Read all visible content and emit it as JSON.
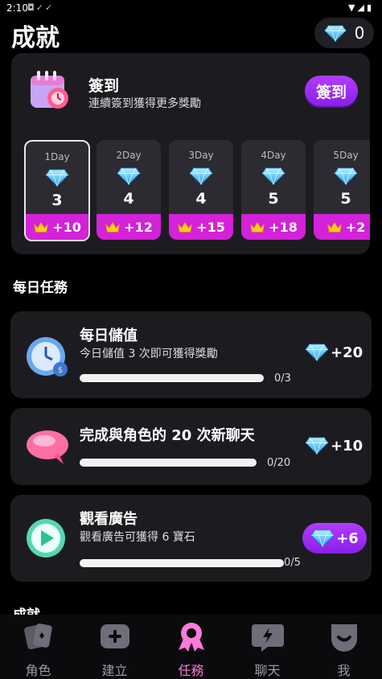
{
  "status_bar": {
    "time": "2:10",
    "icons": [
      "camera-icon",
      "check-icon",
      "check-icon"
    ],
    "right_icons": [
      "wifi-icon",
      "signal-icon",
      "battery-icon"
    ]
  },
  "header": {
    "title": "成就",
    "gem_count": "0"
  },
  "checkin": {
    "title": "簽到",
    "subtitle": "連續簽到獲得更多獎勵",
    "button_label": "簽到",
    "days": [
      {
        "label": "1Day",
        "value": "3",
        "bonus": "+10",
        "active": true
      },
      {
        "label": "2Day",
        "value": "4",
        "bonus": "+12",
        "active": false
      },
      {
        "label": "3Day",
        "value": "4",
        "bonus": "+15",
        "active": false
      },
      {
        "label": "4Day",
        "value": "5",
        "bonus": "+18",
        "active": false
      },
      {
        "label": "5Day",
        "value": "5",
        "bonus": "+2",
        "active": false
      }
    ]
  },
  "daily": {
    "section_title": "每日任務",
    "tasks": [
      {
        "title": "每日儲值",
        "subtitle": "今日儲值 3 次即可獲得獎勵",
        "progress": "0/3",
        "progress_fraction": 0,
        "reward": "+20"
      },
      {
        "title": "完成與角色的 20 次新聊天",
        "subtitle": "",
        "progress": "0/20",
        "progress_fraction": 0,
        "reward": "+10"
      },
      {
        "title": "觀看廣告",
        "subtitle": "觀看廣告可獲得 6 寶石",
        "progress": "0/5",
        "progress_fraction": 0,
        "reward": "+6"
      }
    ]
  },
  "achievements_peek": "成就",
  "tabs": [
    {
      "label": "角色",
      "icon": "cards-icon",
      "active": false
    },
    {
      "label": "建立",
      "icon": "add-icon",
      "active": false
    },
    {
      "label": "任務",
      "icon": "ribbon-icon",
      "active": true
    },
    {
      "label": "聊天",
      "icon": "chat-bolt-icon",
      "active": false
    },
    {
      "label": "我",
      "icon": "profile-icon",
      "active": false
    }
  ],
  "colors": {
    "accent_purple": "#a02ff0",
    "bonus_magenta": "#d322d9",
    "active_tab": "#ff7ad9",
    "card_bg": "#1c1c20"
  }
}
